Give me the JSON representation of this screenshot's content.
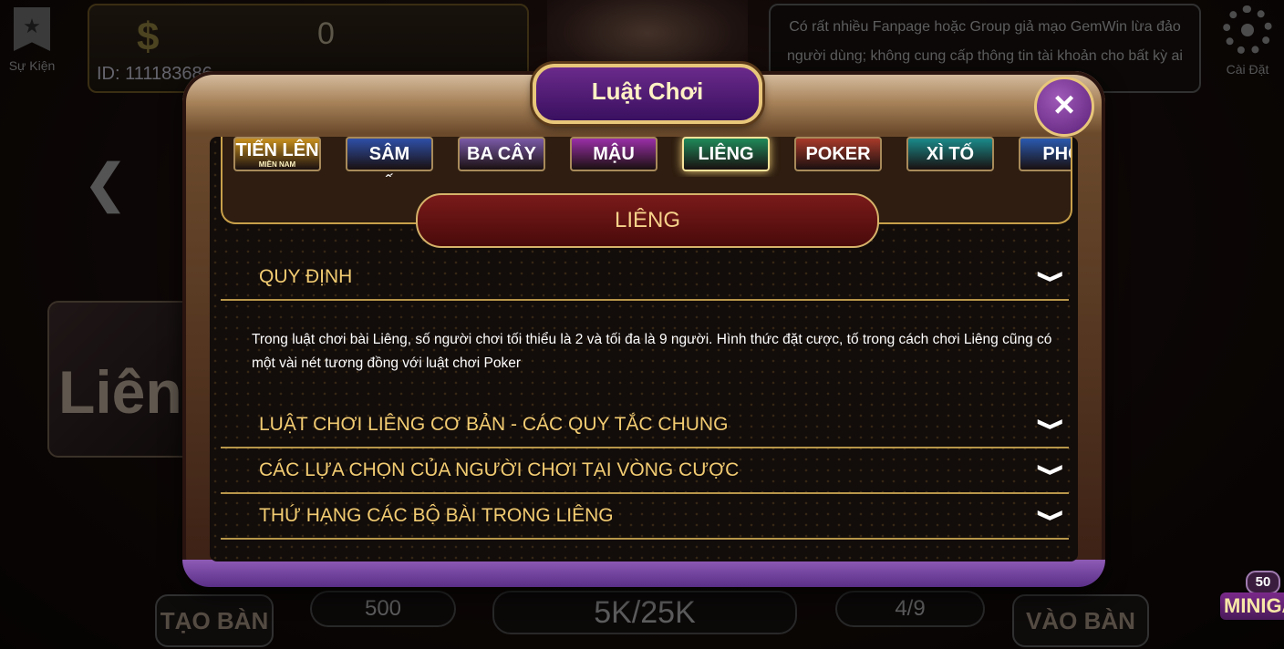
{
  "top_left": {
    "label": "Sự Kiện",
    "icon": "event-star-icon"
  },
  "wallet": {
    "currency_symbol": "$",
    "balance": "0",
    "user_id": "ID: 111183686"
  },
  "notice": {
    "text": "Có rất nhiều Fanpage hoặc Group giả mạo GemWin lừa đảo người dùng; không cung cấp thông tin tài khoản cho bất kỳ ai ngoài trong game."
  },
  "top_right": {
    "label": "Cài Đặt",
    "icon": "gear-icon"
  },
  "background": {
    "card_title": "Liêng"
  },
  "bottom": {
    "create_table": "TẠO BÀN",
    "min_bet": "500",
    "stakes": "5K/25K",
    "players": "4/9",
    "join_table": "VÀO BÀN"
  },
  "minigame": {
    "count": "50",
    "label": "MINIGA"
  },
  "modal": {
    "title": "Luật Chơi",
    "close": "×",
    "game_tabs": [
      {
        "label": "TIẾN LÊN",
        "sub": "MIỀN NAM",
        "color": "#c8901e"
      },
      {
        "label": "SÂM LỐC",
        "color": "#2e4fa8"
      },
      {
        "label": "BA CÂY",
        "color": "#7a5aa8"
      },
      {
        "label": "MẬU BINH",
        "color": "#9a2fa8"
      },
      {
        "label": "LIÊNG",
        "color": "#1f8a5a"
      },
      {
        "label": "POKER",
        "color": "#a83a2a"
      },
      {
        "label": "XÌ TỐ",
        "color": "#1a8a8a"
      },
      {
        "label": "PHỎ",
        "color": "#2a5ab0"
      }
    ],
    "active_tab": 4,
    "game_name": "LIÊNG",
    "sections": [
      {
        "title": "QUY ĐỊNH",
        "expanded": true,
        "body": "Trong luật chơi bài Liêng, số người chơi tối thiểu là 2 và tối đa là 9 người. Hình thức đặt cược, tố trong cách chơi Liêng cũng có một vài nét tương đồng với luật chơi Poker"
      },
      {
        "title": "LUẬT CHƠI LIÊNG CƠ BẢN - CÁC QUY TẮC CHUNG",
        "expanded": false
      },
      {
        "title": "CÁC LỰA CHỌN CỦA NGƯỜI CHƠI TẠI VÒNG CƯỢC",
        "expanded": false
      },
      {
        "title": "THỨ HẠNG CÁC BỘ BÀI TRONG LIÊNG",
        "expanded": false
      }
    ],
    "chevron": "❯"
  }
}
